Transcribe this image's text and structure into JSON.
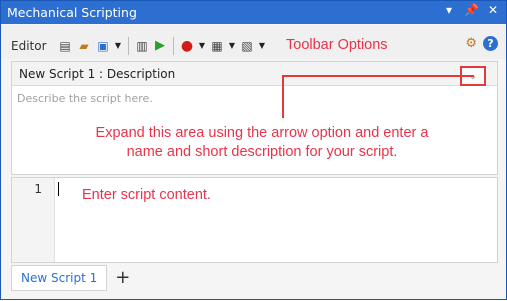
{
  "window": {
    "title": "Mechanical Scripting"
  },
  "titlebar_icons": [
    "dropdown-arrow-icon",
    "pin-icon",
    "close-icon"
  ],
  "toolbar": {
    "editor_label": "Editor",
    "annotation": "Toolbar Options"
  },
  "description": {
    "header": "New Script 1  : Description",
    "placeholder": "Describe the script here.",
    "annotation": "Expand this area using the arrow option and enter a name and short description for your script."
  },
  "script": {
    "line_number": "1",
    "annotation": "Enter script content."
  },
  "tabs": [
    {
      "label": "New Script 1"
    }
  ],
  "add_tab_label": "+",
  "colors": {
    "titlebar": "#2d6fd1",
    "annotation": "#e8344a",
    "run": "#2aa02a",
    "record": "#d21a1a"
  }
}
